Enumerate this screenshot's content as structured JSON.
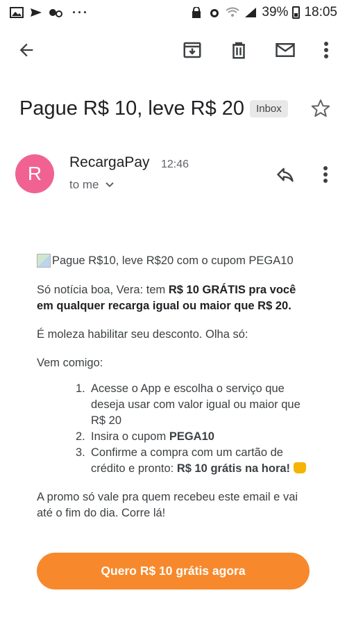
{
  "status_bar": {
    "battery": "39%",
    "time": "18:05",
    "dots": "···"
  },
  "email": {
    "subject": "Pague R$ 10, leve R$ 20",
    "label": "Inbox",
    "sender": {
      "initial": "R",
      "name": "RecargaPay",
      "time": "12:46",
      "recipient": "to me"
    },
    "image_alt": "Pague R$10, leve R$20 com o cupom PEGA10",
    "greeting_normal": "Só notícia boa, Vera: tem ",
    "greeting_bold": "R$ 10 GRÁTIS pra você em qualquer recarga igual ou maior que R$ 20.",
    "intro": "É moleza habilitar seu desconto. Olha só:",
    "lead": "Vem comigo:",
    "steps": [
      {
        "num": "1.",
        "text": "Acesse o App e escolha o serviço que deseja usar com valor igual ou maior que R$ 20"
      },
      {
        "num": "2.",
        "text": "Insira o cupom ",
        "bold": "PEGA10"
      },
      {
        "num": "3.",
        "text": "Confirme a compra com um cartão de crédito e pronto: ",
        "bold": "R$ 10 grátis na hora!"
      }
    ],
    "closing": "A promo só vale pra quem recebeu este email e vai até o fim do dia. Corre lá!",
    "cta": "Quero R$ 10 grátis agora"
  },
  "colors": {
    "avatar": "#f06292",
    "cta": "#f7892c"
  },
  "icons": [
    "back-arrow-icon",
    "archive-icon",
    "delete-icon",
    "mail-icon",
    "more-vert-icon",
    "star-outline-icon",
    "reply-icon",
    "chevron-down-icon"
  ]
}
